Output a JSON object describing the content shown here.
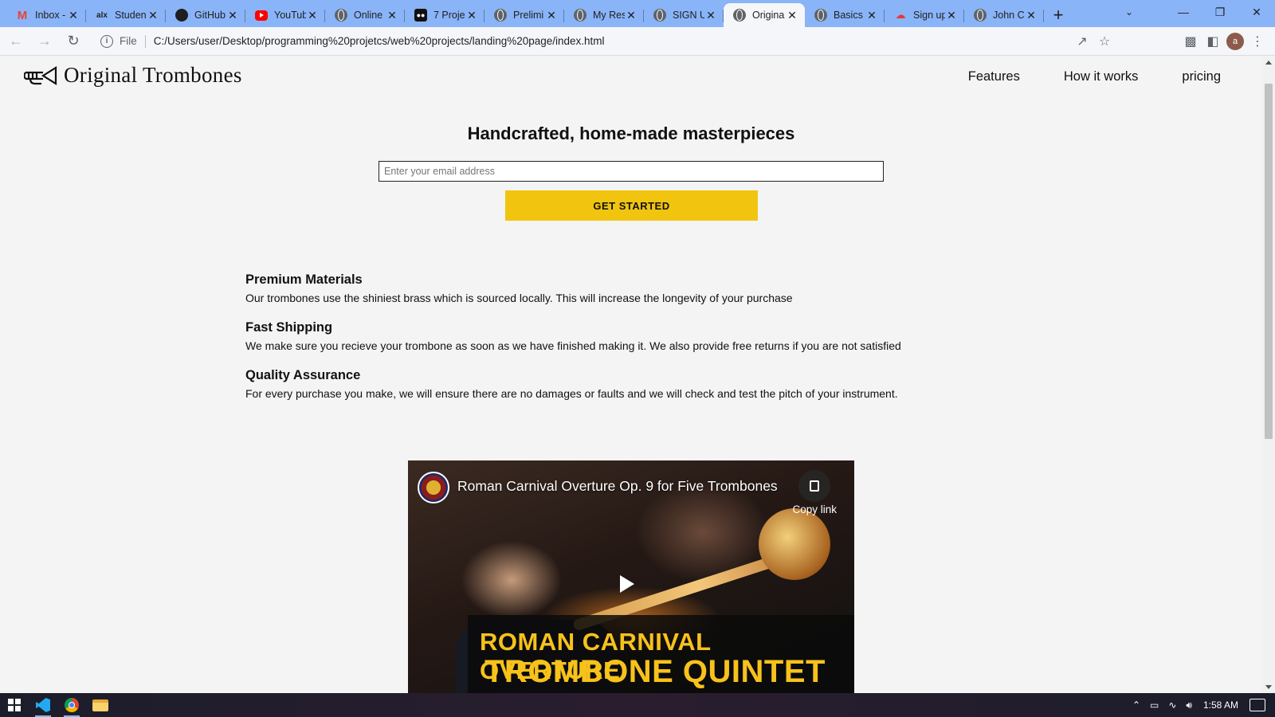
{
  "browser": {
    "tabs": [
      {
        "title": "Inbox -",
        "icon": "gmail-icon",
        "active": false
      },
      {
        "title": "Studen",
        "icon": "alx-icon",
        "active": false
      },
      {
        "title": "GitHub",
        "icon": "github-icon",
        "active": false
      },
      {
        "title": "YouTub",
        "icon": "youtube-icon",
        "active": false
      },
      {
        "title": "Online",
        "icon": "globe-icon",
        "active": false
      },
      {
        "title": "7 Proje",
        "icon": "medium-icon",
        "active": false
      },
      {
        "title": "Prelimi",
        "icon": "globe-icon",
        "active": false
      },
      {
        "title": "My Res",
        "icon": "globe-icon",
        "active": false
      },
      {
        "title": "SIGN U",
        "icon": "globe-icon",
        "active": false
      },
      {
        "title": "Origina",
        "icon": "globe-icon",
        "active": true
      },
      {
        "title": "Basics",
        "icon": "globe-icon",
        "active": false
      },
      {
        "title": "Sign up",
        "icon": "signup-icon",
        "active": false
      },
      {
        "title": "John C",
        "icon": "globe-icon",
        "active": false
      }
    ],
    "omnibox": {
      "scheme_label": "File",
      "url": "C:/Users/user/Desktop/programming%20projetcs/web%20projects/landing%20page/index.html"
    },
    "profile_initial": "a"
  },
  "site": {
    "logo_text": "Original Trombones",
    "nav": [
      "Features",
      "How it works",
      "pricing"
    ],
    "hero": {
      "heading": "Handcrafted, home-made masterpieces",
      "email_placeholder": "Enter your email address",
      "cta_label": "GET STARTED"
    },
    "features": [
      {
        "title": "Premium Materials",
        "text": "Our trombones use the shiniest brass which is sourced locally. This will increase the longevity of your purchase"
      },
      {
        "title": "Fast Shipping",
        "text": "We make sure you recieve your trombone as soon as we have finished making it. We also provide free returns if you are not satisfied"
      },
      {
        "title": "Quality Assurance",
        "text": "For every purchase you make, we will ensure there are no damages or faults and we will check and test the pitch of your instrument."
      }
    ],
    "video": {
      "title": "Roman Carnival Overture Op. 9 for Five Trombones",
      "copy_link_label": "Copy link",
      "banner_line1": "ROMAN CARNIVAL OVERTURE",
      "banner_line2": "TROMBONE QUINTET"
    }
  },
  "taskbar": {
    "clock": "1:58 AM"
  },
  "colors": {
    "tabbar": "#8ab4f8",
    "cta": "#f1c40f",
    "video_banner_text": "#f7c21b"
  }
}
